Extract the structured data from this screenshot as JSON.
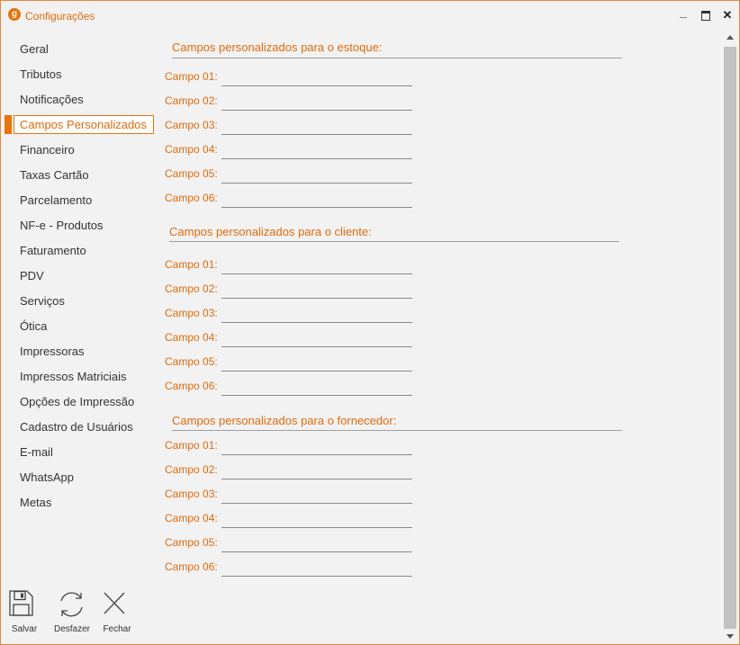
{
  "window": {
    "title": "Configurações"
  },
  "sidebar": {
    "items": [
      "Geral",
      "Tributos",
      "Notificações",
      "Campos Personalizados",
      "Financeiro",
      "Taxas Cartão",
      "Parcelamento",
      "NF-e - Produtos",
      "Faturamento",
      "PDV",
      "Serviços",
      "Ótica",
      "Impressoras",
      "Impressos Matriciais",
      "Opções de Impressão",
      "Cadastro de Usuários",
      "E-mail",
      "WhatsApp",
      "Metas"
    ],
    "active": "Campos Personalizados"
  },
  "sections": [
    {
      "title": "Campos personalizados para o estoque:",
      "fields": [
        {
          "label": "Campo 01:",
          "value": ""
        },
        {
          "label": "Campo 02:",
          "value": ""
        },
        {
          "label": "Campo 03:",
          "value": ""
        },
        {
          "label": "Campo 04:",
          "value": ""
        },
        {
          "label": "Campo 05:",
          "value": ""
        },
        {
          "label": "Campo 06:",
          "value": ""
        }
      ]
    },
    {
      "title": "Campos personalizados para o cliente:",
      "fields": [
        {
          "label": "Campo 01:",
          "value": ""
        },
        {
          "label": "Campo 02:",
          "value": ""
        },
        {
          "label": "Campo 03:",
          "value": ""
        },
        {
          "label": "Campo 04:",
          "value": ""
        },
        {
          "label": "Campo 05:",
          "value": ""
        },
        {
          "label": "Campo 06:",
          "value": ""
        }
      ]
    },
    {
      "title": "Campos personalizados para o fornecedor:",
      "fields": [
        {
          "label": "Campo 01:",
          "value": ""
        },
        {
          "label": "Campo 02:",
          "value": ""
        },
        {
          "label": "Campo 03:",
          "value": ""
        },
        {
          "label": "Campo 04:",
          "value": ""
        },
        {
          "label": "Campo 05:",
          "value": ""
        },
        {
          "label": "Campo 06:",
          "value": ""
        }
      ]
    }
  ],
  "toolbar": {
    "save_label": "Salvar",
    "undo_label": "Desfazer",
    "close_label": "Fechar"
  },
  "colors": {
    "accent": "#e8730c",
    "background": "#f2f2f2",
    "text": "#333333"
  }
}
